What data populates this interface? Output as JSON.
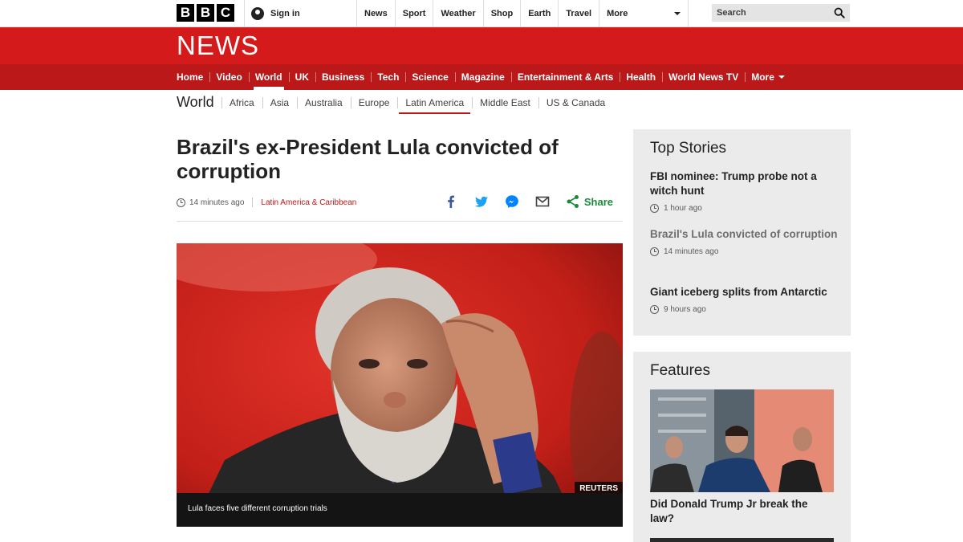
{
  "masthead": {
    "logo_letters": [
      "B",
      "B",
      "C"
    ],
    "signin_label": "Sign in",
    "nav": [
      "News",
      "Sport",
      "Weather",
      "Shop",
      "Earth",
      "Travel"
    ],
    "more_label": "More",
    "search_placeholder": "Search"
  },
  "banner": {
    "wordmark": "NEWS",
    "brand_color": "#bb1919"
  },
  "main_nav": {
    "items": [
      "Home",
      "Video",
      "World",
      "UK",
      "Business",
      "Tech",
      "Science",
      "Magazine",
      "Entertainment & Arts",
      "Health",
      "World News TV",
      "More"
    ],
    "active": "World"
  },
  "sub_nav": {
    "section": "World",
    "items": [
      "Africa",
      "Asia",
      "Australia",
      "Europe",
      "Latin America",
      "Middle East",
      "US & Canada"
    ],
    "active": "Latin America"
  },
  "article": {
    "headline": "Brazil's ex-President Lula convicted of corruption",
    "time": "14 minutes ago",
    "tag": "Latin America & Caribbean",
    "share_label": "Share",
    "share_icons": [
      "facebook-icon",
      "twitter-icon",
      "messenger-icon",
      "email-icon",
      "share-icon"
    ],
    "image_credit": "REUTERS",
    "image_caption": "Lula faces five different corruption trials"
  },
  "top_stories": {
    "heading": "Top Stories",
    "items": [
      {
        "title": "FBI nominee: Trump probe not a witch hunt",
        "time": "1 hour ago"
      },
      {
        "title": "Brazil's Lula convicted of corruption",
        "time": "14 minutes ago"
      },
      {
        "title": "Giant iceberg splits from Antarctic",
        "time": "9 hours ago"
      }
    ]
  },
  "features": {
    "heading": "Features",
    "items": [
      {
        "title": "Did Donald Trump Jr break the law?"
      }
    ]
  }
}
